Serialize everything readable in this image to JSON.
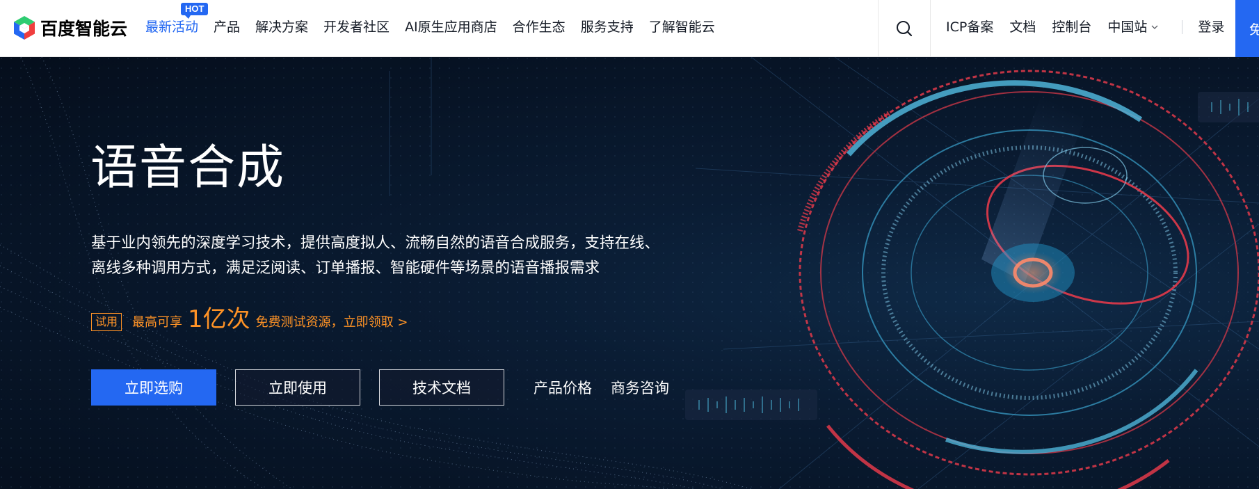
{
  "brand": {
    "name": "百度智能云",
    "colors": {
      "primary": "#2468f2",
      "promo": "#ff9326",
      "hero_bg": "#071426"
    }
  },
  "nav": {
    "hot_badge": "HOT",
    "links": [
      "最新活动",
      "产品",
      "解决方案",
      "开发者社区",
      "AI原生应用商店",
      "合作生态",
      "服务支持",
      "了解智能云"
    ],
    "active_index": 0,
    "search_icon": "search-icon",
    "right_links": [
      "ICP备案",
      "文档",
      "控制台"
    ],
    "region": "中国站",
    "login": "登录",
    "cta": "免"
  },
  "hero": {
    "title": "语音合成",
    "description_line1": "基于业内领先的深度学习技术，提供高度拟人、流畅自然的语音合成服务，支持在线、",
    "description_line2": "离线多种调用方式，满足泛阅读、订单播报、智能硬件等场景的语音播报需求",
    "promo": {
      "tag": "试用",
      "prefix": "最高可享",
      "highlight": "1亿次",
      "suffix": "免费测试资源，立即领取 >"
    },
    "buttons": {
      "buy": "立即选购",
      "use": "立即使用",
      "docs": "技术文档",
      "pricing": "产品价格",
      "consult": "商务咨询"
    }
  }
}
